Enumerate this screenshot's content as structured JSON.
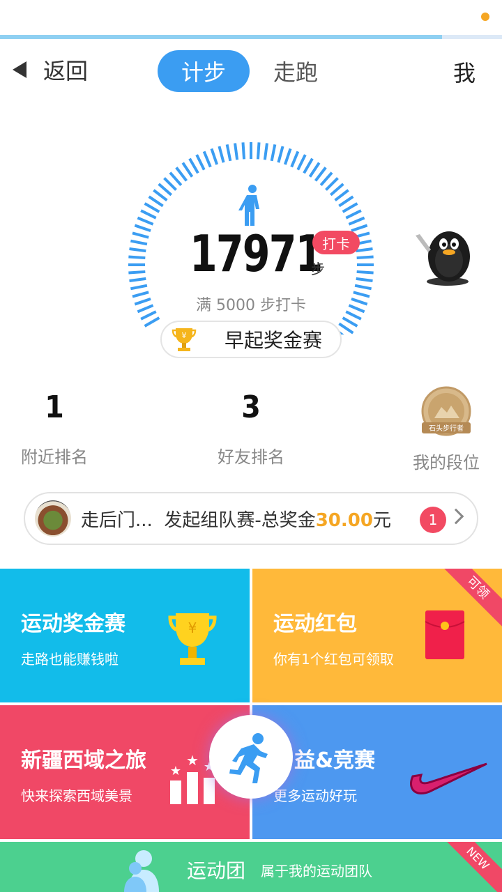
{
  "nav": {
    "back_label": "返回",
    "tabs": [
      {
        "label": "计步",
        "active": true
      },
      {
        "label": "走跑",
        "active": false
      }
    ],
    "me_label": "我"
  },
  "steps": {
    "count": "17971",
    "unit": "步",
    "checkin_label": "打卡",
    "goal_text": "满 5000 步打卡",
    "early_contest_label": "早起奖金赛"
  },
  "stats": [
    {
      "value": "1",
      "label": "附近排名"
    },
    {
      "value": "3",
      "label": "好友排名"
    },
    {
      "value": "",
      "label": "我的段位",
      "medal_text": "石头步行者"
    }
  ],
  "team_banner": {
    "name": "走后门...",
    "text": "发起组队赛-总奖金",
    "amount": "30.00",
    "suffix": "元",
    "badge_count": "1"
  },
  "tiles": {
    "bonus": {
      "title": "运动奖金赛",
      "subtitle": "走路也能赚钱啦"
    },
    "redpack": {
      "title": "运动红包",
      "subtitle": "你有1个红包可领取",
      "corner": "可领"
    },
    "journey": {
      "title": "新疆西域之旅",
      "subtitle": "快来探索西域美景"
    },
    "charity": {
      "title": "益&竞赛",
      "subtitle": "更多运动好玩"
    },
    "team": {
      "title": "运动团",
      "subtitle": "属于我的运动团队",
      "corner": "NEW"
    }
  },
  "colors": {
    "accent": "#3b9df2",
    "badge_red": "#f24a62",
    "amount_orange": "#f5a623",
    "tile_blue": "#12bcea",
    "tile_yellow": "#ffb93a",
    "tile_pink": "#f04866",
    "tile_lightblue": "#4d98f0",
    "tile_green": "#4cd08f"
  },
  "progress_line_fraction": 0.88
}
